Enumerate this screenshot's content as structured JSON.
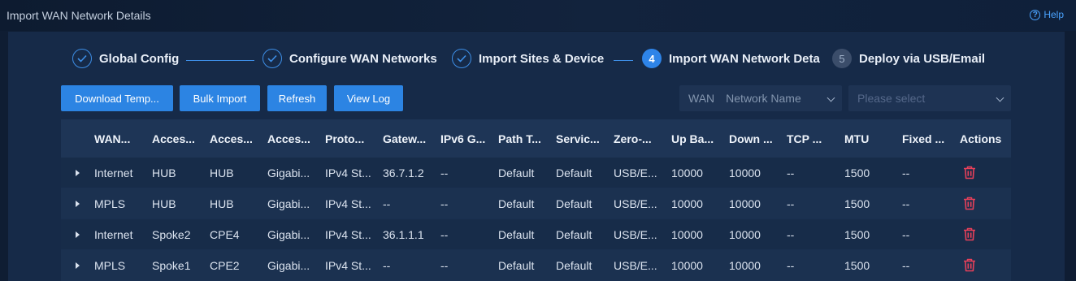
{
  "header": {
    "title": "Import WAN Network Details",
    "help_label": "Help"
  },
  "steps": [
    {
      "number": "",
      "label": "Global Config",
      "state": "done"
    },
    {
      "number": "",
      "label": "Configure WAN Networks",
      "state": "done"
    },
    {
      "number": "",
      "label": "Import Sites & Device",
      "state": "done"
    },
    {
      "number": "4",
      "label": "Import WAN Network Deta",
      "state": "active"
    },
    {
      "number": "5",
      "label": "Deploy via USB/Email",
      "state": "todo"
    }
  ],
  "toolbar": {
    "download_label": "Download Temp...",
    "bulk_import_label": "Bulk Import",
    "refresh_label": "Refresh",
    "view_log_label": "View Log"
  },
  "filters": {
    "type_value": "WAN",
    "name_value": "Network Name",
    "select_placeholder": "Please select"
  },
  "table": {
    "columns": [
      "WAN...",
      "Acces...",
      "Acces...",
      "Acces...",
      "Proto...",
      "Gatew...",
      "IPv6 G...",
      "Path T...",
      "Servic...",
      "Zero-...",
      "Up Ba...",
      "Down ...",
      "TCP ...",
      "MTU",
      "Fixed ...",
      "Actions"
    ],
    "rows": [
      [
        "Internet",
        "HUB",
        "HUB",
        "Gigabi...",
        "IPv4 St...",
        "36.7.1.2",
        "--",
        "Default",
        "Default",
        "USB/E...",
        "10000",
        "10000",
        "--",
        "1500",
        "--"
      ],
      [
        "MPLS",
        "HUB",
        "HUB",
        "Gigabi...",
        "IPv4 St...",
        "--",
        "--",
        "Default",
        "Default",
        "USB/E...",
        "10000",
        "10000",
        "--",
        "1500",
        "--"
      ],
      [
        "Internet",
        "Spoke2",
        "CPE4",
        "Gigabi...",
        "IPv4 St...",
        "36.1.1.1",
        "--",
        "Default",
        "Default",
        "USB/E...",
        "10000",
        "10000",
        "--",
        "1500",
        "--"
      ],
      [
        "MPLS",
        "Spoke1",
        "CPE2",
        "Gigabi...",
        "IPv4 St...",
        "--",
        "--",
        "Default",
        "Default",
        "USB/E...",
        "10000",
        "10000",
        "--",
        "1500",
        "--"
      ]
    ]
  },
  "colors": {
    "accent": "#2c84e3",
    "delete": "#e8405a",
    "panel": "#162a48"
  }
}
